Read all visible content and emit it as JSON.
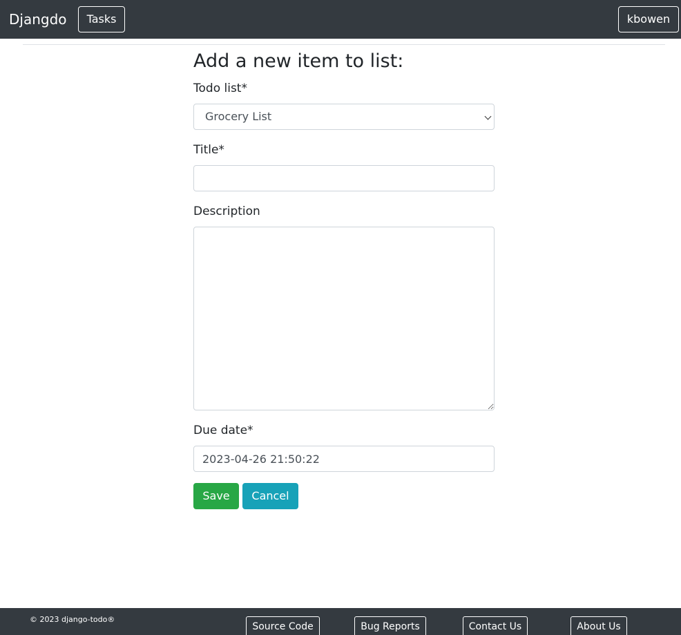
{
  "navbar": {
    "brand": "Djangdo",
    "tasks_label": "Tasks",
    "user_label": "kbowen"
  },
  "form": {
    "title": "Add a new item to list:",
    "todo_list": {
      "label": "Todo list*",
      "selected": "Grocery List"
    },
    "title_field": {
      "label": "Title*",
      "value": ""
    },
    "description": {
      "label": "Description",
      "value": ""
    },
    "due_date": {
      "label": "Due date*",
      "value": "2023-04-26 21:50:22"
    },
    "save_label": "Save",
    "cancel_label": "Cancel"
  },
  "colors": {
    "navbar_bg": "#343a40",
    "save_bg": "#28a745",
    "cancel_bg": "#17a2b8"
  },
  "footer": {
    "copyright": "© 2023 django-todo®",
    "links": {
      "source": "Source Code",
      "bugs": "Bug Reports",
      "contact": "Contact Us",
      "about": "About Us"
    }
  }
}
